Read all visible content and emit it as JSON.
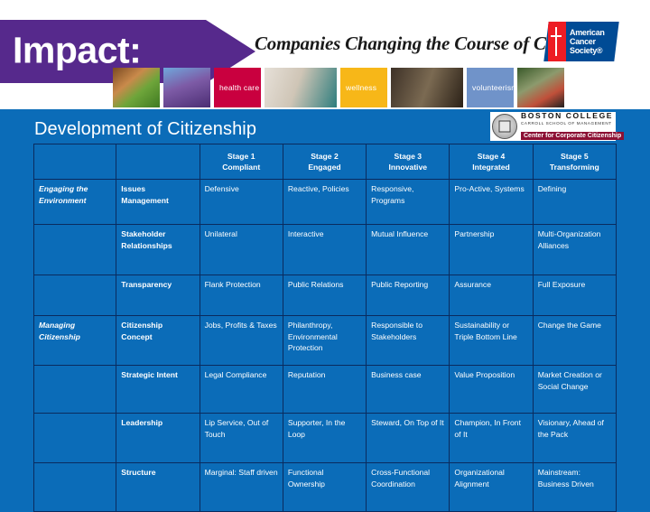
{
  "banner": {
    "arrow_label": "Impact:",
    "tagline": "Companies Changing the Course of Cancer",
    "acs_logo": {
      "line1": "American",
      "line2": "Cancer",
      "line3": "Society®"
    },
    "photo_strip": [
      {
        "name": "food-photo",
        "label": ""
      },
      {
        "name": "relay-photo",
        "label": ""
      },
      {
        "name": "health-care-tile",
        "label": "health care"
      },
      {
        "name": "doctor-photo",
        "label": ""
      },
      {
        "name": "wellness-tile",
        "label": "wellness"
      },
      {
        "name": "business-photo",
        "label": ""
      },
      {
        "name": "volunteerism-tile",
        "label": "volunteerism"
      },
      {
        "name": "cycling-photo",
        "label": ""
      }
    ]
  },
  "slide": {
    "title": "Development of Citizenship",
    "bc_logo": {
      "name": "BOSTON COLLEGE",
      "school": "CARROLL SCHOOL OF MANAGEMENT",
      "center": "Center for Corporate Citizenship"
    }
  },
  "colors": {
    "blue_background": "#0b6cb8",
    "purple_arrow": "#56298c",
    "grid_line": "#0a2b5e",
    "text": "#ffffff",
    "acs_red": "#ed1c24",
    "acs_blue": "#004b95",
    "bc_maroon": "#8c1034"
  },
  "table": {
    "headers": [
      {
        "stage": "",
        "name": ""
      },
      {
        "stage": "",
        "name": ""
      },
      {
        "stage": "Stage 1",
        "name": "Compliant"
      },
      {
        "stage": "Stage 2",
        "name": "Engaged"
      },
      {
        "stage": "Stage 3",
        "name": "Innovative"
      },
      {
        "stage": "Stage 4",
        "name": "Integrated"
      },
      {
        "stage": "Stage 5",
        "name": "Transforming"
      }
    ],
    "rows": [
      {
        "group": "Engaging the Environment",
        "aspect": "Issues Management",
        "cells": [
          "Defensive",
          "Reactive, Policies",
          "Responsive, Programs",
          "Pro-Active, Systems",
          "Defining"
        ]
      },
      {
        "group": "",
        "aspect": "Stakeholder Relationships",
        "cells": [
          "Unilateral",
          "Interactive",
          "Mutual Influence",
          "Partnership",
          "Multi-Organization Alliances"
        ]
      },
      {
        "group": "",
        "aspect": "Transparency",
        "cells": [
          "Flank Protection",
          "Public Relations",
          "Public Reporting",
          "Assurance",
          "Full Exposure"
        ]
      },
      {
        "group": "Managing Citizenship",
        "aspect": "Citizenship Concept",
        "cells": [
          "Jobs, Profits & Taxes",
          "Philanthropy, Environmental Protection",
          "Responsible to Stakeholders",
          "Sustainability or Triple Bottom Line",
          "Change the Game"
        ]
      },
      {
        "group": "",
        "aspect": "Strategic Intent",
        "cells": [
          "Legal Compliance",
          "Reputation",
          "Business case",
          "Value Proposition",
          "Market Creation or Social Change"
        ]
      },
      {
        "group": "",
        "aspect": "Leadership",
        "cells": [
          "Lip Service, Out of Touch",
          "Supporter, In the Loop",
          "Steward, On Top of It",
          "Champion, In Front of It",
          "Visionary, Ahead of the Pack"
        ]
      },
      {
        "group": "",
        "aspect": "Structure",
        "cells": [
          "Marginal: Staff driven",
          "Functional Ownership",
          "Cross-Functional Coordination",
          "Organizational Alignment",
          "Mainstream: Business Driven"
        ]
      }
    ]
  }
}
